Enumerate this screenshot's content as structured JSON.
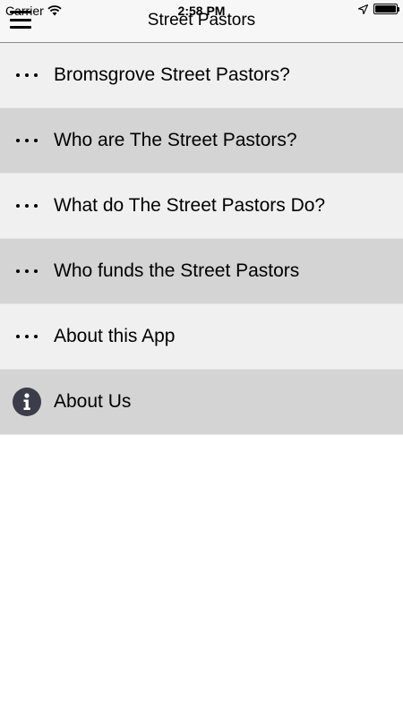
{
  "status_bar": {
    "carrier": "Carrier",
    "time": "2:58 PM",
    "battery_level": 1.0
  },
  "nav": {
    "title": "Street Pastors",
    "menu_icon": "hamburger-menu-icon"
  },
  "menu": {
    "items": [
      {
        "label": "Bromsgrove Street Pastors?",
        "icon": "more-dots-icon"
      },
      {
        "label": "Who are The Street Pastors?",
        "icon": "more-dots-icon"
      },
      {
        "label": "What do The Street Pastors Do?",
        "icon": "more-dots-icon"
      },
      {
        "label": "Who funds the Street Pastors",
        "icon": "more-dots-icon"
      },
      {
        "label": "About this App",
        "icon": "more-dots-icon"
      },
      {
        "label": "About Us",
        "icon": "info-icon"
      }
    ]
  },
  "colors": {
    "row_light": "#f0f0f0",
    "row_dark": "#d4d4d4",
    "info_icon_bg": "#3b3d4a",
    "nav_bg": "#f7f7f7"
  }
}
